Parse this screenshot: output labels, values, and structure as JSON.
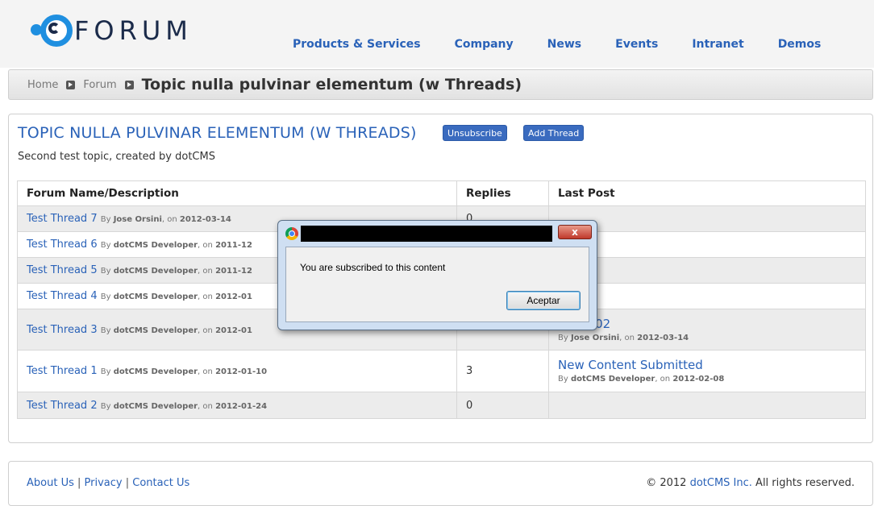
{
  "header": {
    "logo_text": "FORUM",
    "nav": [
      "Products & Services",
      "Company",
      "News",
      "Events",
      "Intranet",
      "Demos"
    ]
  },
  "breadcrumb": {
    "home": "Home",
    "forum": "Forum",
    "current": "Topic nulla pulvinar elementum (w Threads)"
  },
  "topic": {
    "title": "TOPIC NULLA PULVINAR ELEMENTUM (W THREADS)",
    "unsubscribe_label": "Unsubscribe",
    "add_thread_label": "Add Thread",
    "description": "Second test topic, created by dotCMS"
  },
  "table": {
    "headers": [
      "Forum Name/Description",
      "Replies",
      "Last Post"
    ],
    "rows": [
      {
        "name": "Test Thread 7",
        "by": "By",
        "author": "Jose Orsini",
        "on": ", on",
        "date": "2012-03-14",
        "replies": "0",
        "last_title": "",
        "last_by": "",
        "last_author": "",
        "last_on": "",
        "last_date": ""
      },
      {
        "name": "Test Thread 6",
        "by": "By",
        "author": "dotCMS Developer",
        "on": ", on",
        "date": "2011-12",
        "replies": "",
        "last_title": "",
        "last_by": "",
        "last_author": "",
        "last_on": "",
        "last_date": ""
      },
      {
        "name": "Test Thread 5",
        "by": "By",
        "author": "dotCMS Developer",
        "on": ", on",
        "date": "2011-12",
        "replies": "",
        "last_title": "",
        "last_by": "",
        "last_author": "",
        "last_on": "",
        "last_date": ""
      },
      {
        "name": "Test Thread 4",
        "by": "By",
        "author": "dotCMS Developer",
        "on": ", on",
        "date": "2012-01",
        "replies": "",
        "last_title": "",
        "last_by": "",
        "last_author": "",
        "last_on": "",
        "last_date": ""
      },
      {
        "name": "Test Thread 3",
        "by": "By",
        "author": "dotCMS Developer",
        "on": ", on",
        "date": "2012-01",
        "replies": "",
        "last_title": "eply 002",
        "last_by": "By",
        "last_author": "Jose Orsini",
        "last_on": ", on",
        "last_date": "2012-03-14"
      },
      {
        "name": "Test Thread 1",
        "by": "By",
        "author": "dotCMS Developer",
        "on": ", on",
        "date": "2012-01-10",
        "replies": "3",
        "last_title": "New Content Submitted",
        "last_by": "By",
        "last_author": "dotCMS Developer",
        "last_on": ", on",
        "last_date": "2012-02-08"
      },
      {
        "name": "Test Thread 2",
        "by": "By",
        "author": "dotCMS Developer",
        "on": ", on",
        "date": "2012-01-24",
        "replies": "0",
        "last_title": "",
        "last_by": "",
        "last_author": "",
        "last_on": "",
        "last_date": ""
      }
    ]
  },
  "footer": {
    "about": "About Us",
    "privacy": "Privacy",
    "contact": "Contact Us",
    "sep": "|",
    "copy_prefix": "© 2012",
    "copy_company": "dotCMS Inc.",
    "copy_suffix": "All rights reserved."
  },
  "dialog": {
    "message": "You are subscribed to this content",
    "ok_label": "Aceptar",
    "close_glyph": "x"
  },
  "colors": {
    "link": "#2a62b8",
    "button": "#3a6bbf",
    "row_alt": "#ececec",
    "dialog_frame": "#cfdff2"
  }
}
